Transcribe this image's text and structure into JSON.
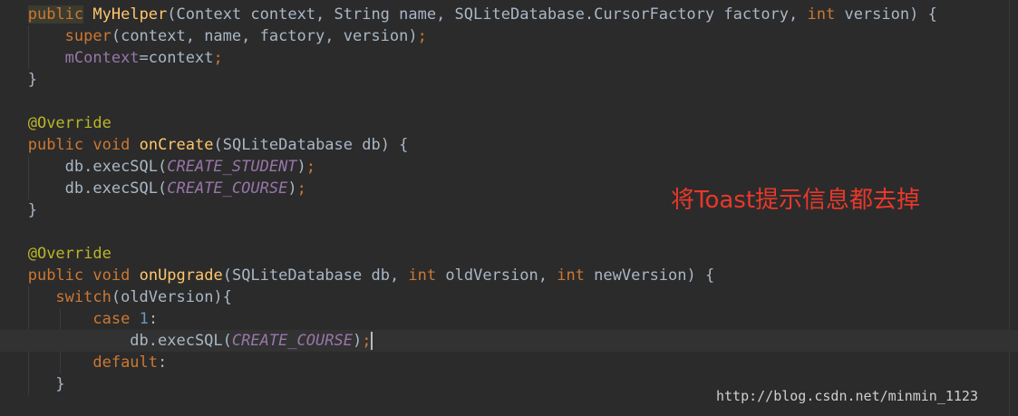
{
  "code": {
    "l1": {
      "kw_public": "public",
      "method": "MyHelper",
      "open": "(Context context, String name, SQLiteDatabase.CursorFactory factory, ",
      "kw_int": "int",
      "close": " version) {"
    },
    "l2": {
      "kw_super": "super",
      "rest": "(context, name, factory, version)",
      "semi": ";"
    },
    "l3": {
      "field": "mContext",
      "rest": "=context",
      "semi": ";"
    },
    "l4": {
      "text": "}"
    },
    "l6": {
      "annotation": "@Override"
    },
    "l7": {
      "kw_public": "public",
      "kw_void": "void",
      "method": "onCreate",
      "rest": "(SQLiteDatabase db) {"
    },
    "l8": {
      "call": "db.execSQL(",
      "const": "CREATE_STUDENT",
      "close": ")",
      "semi": ";"
    },
    "l9": {
      "call": "db.execSQL(",
      "const": "CREATE_COURSE",
      "close": ")",
      "semi": ";"
    },
    "l10": {
      "text": "}"
    },
    "l12": {
      "annotation": "@Override"
    },
    "l13": {
      "kw_public": "public",
      "kw_void": "void",
      "method": "onUpgrade",
      "open": "(SQLiteDatabase db, ",
      "kw_int1": "int",
      "mid": " oldVersion, ",
      "kw_int2": "int",
      "close": " newVersion) {"
    },
    "l14": {
      "kw_switch": "switch",
      "rest": "(oldVersion){"
    },
    "l15": {
      "kw_case": "case",
      "num": "1",
      "colon": ":"
    },
    "l16": {
      "call": "db.execSQL(",
      "const": "CREATE_COURSE",
      "close": ")",
      "semi": ";"
    },
    "l17": {
      "kw_default": "default",
      "colon": ":"
    },
    "l18": {
      "text": "}"
    }
  },
  "annotation_note": "将Toast提示信息都去掉",
  "watermark": "http://blog.csdn.net/minmin_1123",
  "colors": {
    "background": "#2b2b2b",
    "keyword": "#cc7832",
    "method": "#ffc66d",
    "annotation": "#bbb529",
    "field": "#9876aa",
    "number": "#6897bb",
    "text": "#a9b7c6",
    "note": "#e8382b"
  }
}
